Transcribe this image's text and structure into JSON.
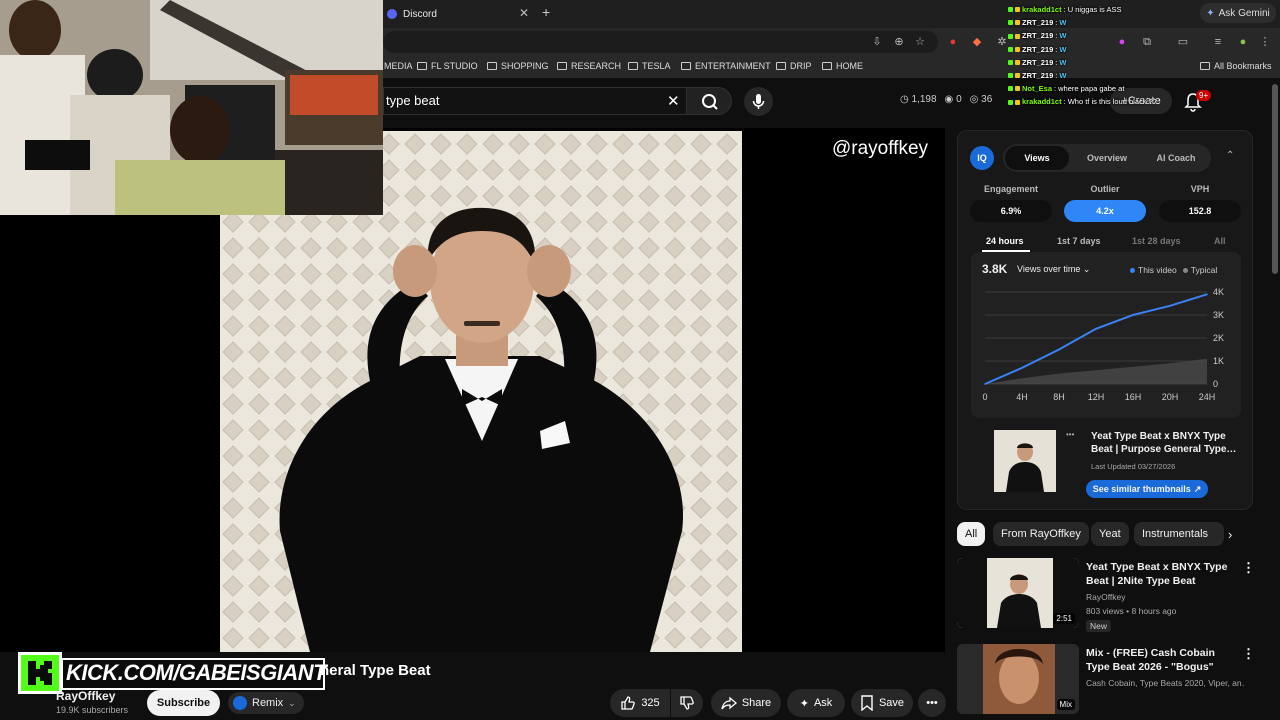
{
  "browser": {
    "tab_title": "Discord",
    "ask_gemini": "Ask Gemini",
    "bookmarks": [
      "MEDIA",
      "FL STUDIO",
      "SHOPPING",
      "RESEARCH",
      "TESLA",
      "ENTERTAINMENT",
      "DRIP",
      "HOME"
    ],
    "all_bookmarks": "All Bookmarks"
  },
  "chat": [
    {
      "user": "krakadd1ct",
      "msg": "U niggas is ASS",
      "color": "#7cfc00"
    },
    {
      "user": "ZRT_219",
      "msg": "W",
      "color": "#ffffff"
    },
    {
      "user": "ZRT_219",
      "msg": "W",
      "color": "#ffffff"
    },
    {
      "user": "ZRT_219",
      "msg": "W",
      "color": "#ffffff"
    },
    {
      "user": "ZRT_219",
      "msg": "W",
      "color": "#ffffff"
    },
    {
      "user": "ZRT_219",
      "msg": "W",
      "color": "#ffffff"
    },
    {
      "user": "Not_Esa",
      "msg": "where papa gabe at",
      "color": "#7cfc00"
    },
    {
      "user": "krakadd1ct",
      "msg": "Who tf is this loud black ??",
      "color": "#7cfc00"
    }
  ],
  "youtube": {
    "search_query": "type beat",
    "stats": {
      "views": "1,198",
      "eye": "0",
      "count": "36"
    },
    "create": "Create",
    "notifications": "9+",
    "watermark": "@rayoffkey",
    "video_title": "neral Type Beat",
    "channel": "RayOffkey",
    "subscribers": "19.9K subscribers",
    "subscribe": "Subscribe",
    "remix": "Remix",
    "likes": "325",
    "share": "Share",
    "ask": "Ask",
    "save": "Save"
  },
  "overlay": {
    "kick_text": "KICK.COM/GABEISGIANT"
  },
  "vidiq": {
    "logo": "IQ",
    "tabs": [
      "Views",
      "Overview",
      "AI Coach"
    ],
    "metrics": [
      {
        "label": "Engagement",
        "value": "6.9%"
      },
      {
        "label": "Outlier",
        "value": "4.2x"
      },
      {
        "label": "VPH",
        "value": "152.8"
      }
    ],
    "ranges": [
      "24 hours",
      "1st 7 days",
      "1st 28 days",
      "All"
    ],
    "views_total": "3.8K",
    "views_dropdown": "Views over time",
    "legend_this": "This video",
    "legend_typical": "Typical",
    "similar_title": "Yeat Type Beat x BNYX Type Beat | Purpose General Type…",
    "last_updated": "Last Updated 03/27/2026",
    "similar_btn": "See similar thumbnails",
    "accent": "#3b82f6"
  },
  "chart_data": {
    "type": "line",
    "x": [
      "0",
      "4H",
      "8H",
      "12H",
      "16H",
      "20H",
      "24H"
    ],
    "series": [
      {
        "name": "This video",
        "values": [
          0,
          700,
          1500,
          2400,
          3000,
          3400,
          3900
        ]
      },
      {
        "name": "Typical",
        "values": [
          0,
          250,
          450,
          600,
          750,
          900,
          1100
        ]
      }
    ],
    "yticks": [
      "0",
      "1K",
      "2K",
      "3K",
      "4K"
    ],
    "ylim": [
      0,
      4000
    ],
    "grid": true
  },
  "chips": [
    "All",
    "From RayOffkey",
    "Yeat",
    "Instrumentals"
  ],
  "recs": [
    {
      "title": "Yeat Type Beat x BNYX Type Beat | 2Nite Type Beat",
      "channel": "RayOffkey",
      "meta": "803 views • 8 hours ago",
      "badge": "New",
      "duration": "2:51"
    },
    {
      "title": "Mix - (FREE) Cash Cobain Type Beat 2026 - \"Bogus\"",
      "channel": "Cash Cobain, Type Beats 2020, Viper, an…",
      "duration": "Mix"
    }
  ]
}
